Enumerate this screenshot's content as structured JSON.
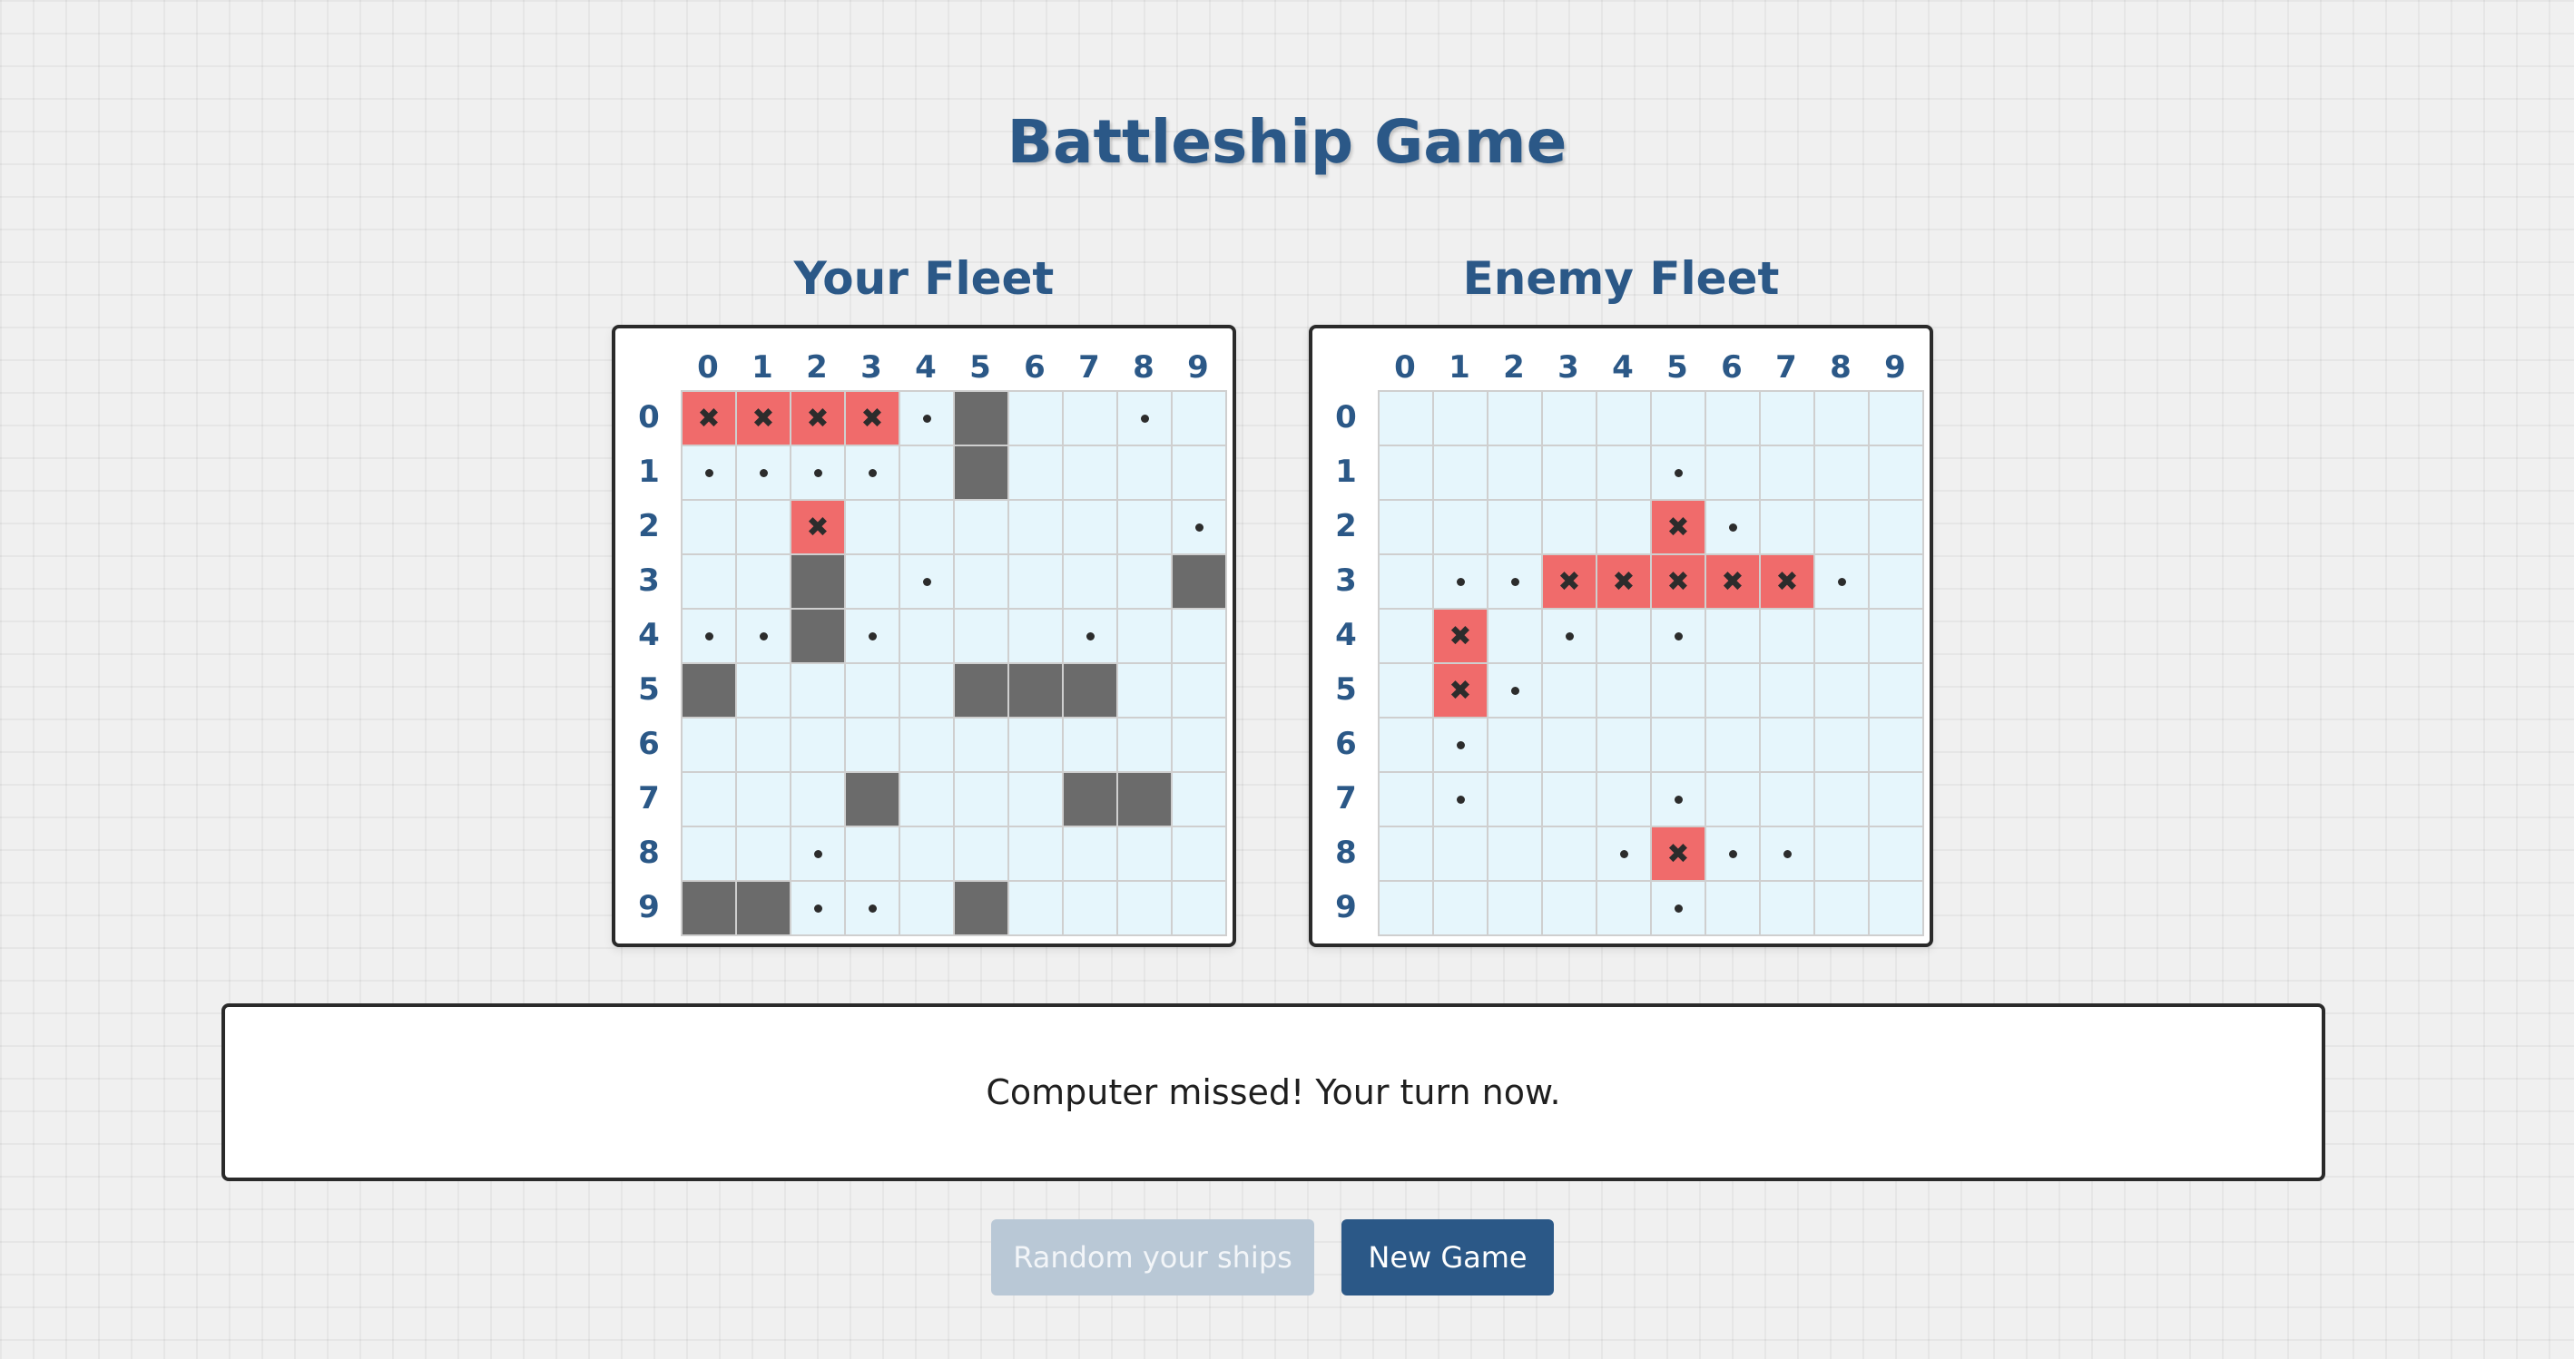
{
  "title": "Battleship Game",
  "colors": {
    "accent": "#2b5887",
    "water": "#e6f6fc",
    "ship": "#6b6b6b",
    "hit": "#f06b6b",
    "disabled_button": "#b9c8d6"
  },
  "col_labels": [
    "0",
    "1",
    "2",
    "3",
    "4",
    "5",
    "6",
    "7",
    "8",
    "9"
  ],
  "row_labels": [
    "0",
    "1",
    "2",
    "3",
    "4",
    "5",
    "6",
    "7",
    "8",
    "9"
  ],
  "legend_codes": {
    ".": "water",
    "S": "ship",
    "X": "hit",
    "o": "miss"
  },
  "player_board": {
    "title": "Your Fleet",
    "rows": [
      "XXXXoS..o.",
      "oooo.S....",
      "..X......o",
      "..S.o....S",
      "ooSo...o..",
      "S....SSS..",
      "..........",
      "...S...SS.",
      "..o.......",
      "SSoo.S...."
    ]
  },
  "enemy_board": {
    "title": "Enemy Fleet",
    "rows": [
      "..........",
      ".....o....",
      ".....Xo...",
      ".ooXXXXXo.",
      ".X.o.o....",
      ".Xo.......",
      ".o........",
      ".o...o....",
      "....oXoo..",
      ".....o...."
    ]
  },
  "status_message": "Computer missed! Your turn now.",
  "buttons": {
    "random_label": "Random your ships",
    "random_disabled": true,
    "new_game_label": "New Game"
  }
}
